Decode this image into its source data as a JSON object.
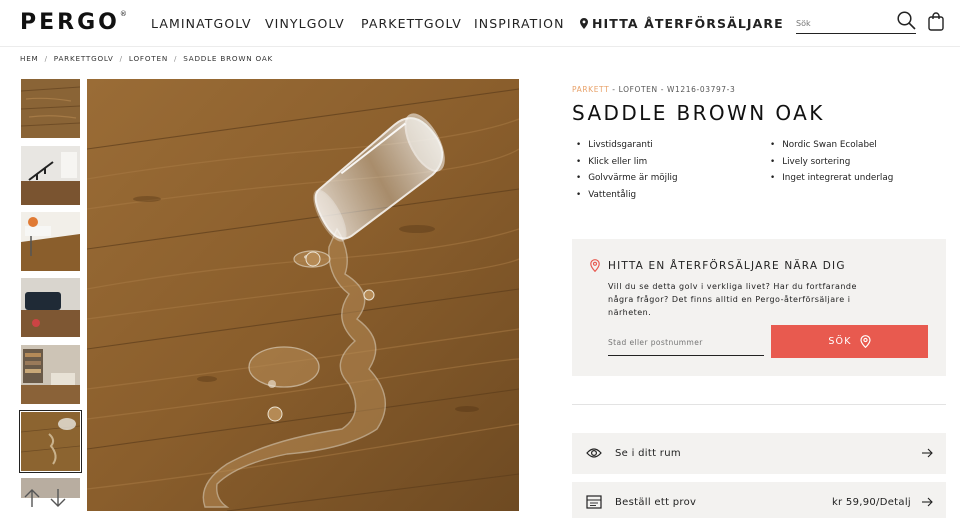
{
  "header": {
    "logo": "PERGO",
    "logo_mark": "®",
    "nav": [
      "LAMINATGOLV",
      "VINYLGOLV",
      "PARKETTGOLV",
      "INSPIRATION"
    ],
    "dealer_link": "HITTA ÅTERFÖRSÄLJARE",
    "search_placeholder": "Sök"
  },
  "breadcrumb": [
    "HEM",
    "PARKETTGOLV",
    "LOFOTEN",
    "SADDLE BROWN OAK"
  ],
  "product": {
    "brand": "PARKETT",
    "collection": "LOFOTEN",
    "sku": "W1216-03797-3",
    "title": "SADDLE BROWN OAK",
    "features_left": [
      "Livstidsgaranti",
      "Klick eller lim",
      "Golvvärme är möjlig",
      "Vattentålig"
    ],
    "features_right": [
      "Nordic Swan Ecolabel",
      "Lively sortering",
      "Inget integrerat underlag"
    ]
  },
  "dealer_finder": {
    "heading": "HITTA EN ÅTERFÖRSÄLJARE NÄRA DIG",
    "text": "Vill du se detta golv i verkliga livet? Har du fortfarande några frågor? Det finns alltid en Pergo-återförsäljare i närheten.",
    "input_placeholder": "Stad eller postnummer",
    "button_label": "SÖK"
  },
  "actions": [
    {
      "label": "Se i ditt rum",
      "icon": "eye-icon"
    },
    {
      "label": "Beställ ett prov",
      "price": "kr 59,90/Detalj",
      "icon": "sample-icon"
    }
  ],
  "colors": {
    "accent": "#e85a4f",
    "brand_tag": "#e8a26a",
    "panel_bg": "#f3f2f0",
    "wood": "#8a5e2c"
  }
}
